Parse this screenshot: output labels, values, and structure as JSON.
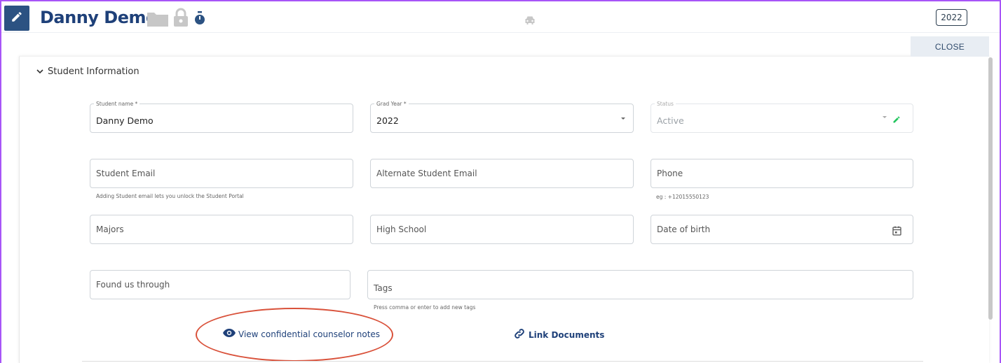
{
  "header": {
    "student_name": "Danny Demo",
    "year_badge": "2022",
    "close_label": "CLOSE"
  },
  "section": {
    "title": "Student Information"
  },
  "fields": {
    "student_name": {
      "label": "Student name *",
      "value": "Danny Demo"
    },
    "grad_year": {
      "label": "Grad Year *",
      "value": "2022"
    },
    "status": {
      "label": "Status",
      "value": "Active"
    },
    "student_email": {
      "placeholder": "Student Email",
      "helper": "Adding Student email lets you unlock the Student Portal"
    },
    "alt_email": {
      "placeholder": "Alternate Student Email"
    },
    "phone": {
      "placeholder": "Phone",
      "helper": "eg : +12015550123"
    },
    "majors": {
      "placeholder": "Majors"
    },
    "high_school": {
      "placeholder": "High School"
    },
    "dob": {
      "placeholder": "Date of birth"
    },
    "found_us": {
      "placeholder": "Found us through"
    },
    "tags": {
      "placeholder": "Tags",
      "helper": "Press comma or enter to add new tags"
    }
  },
  "actions": {
    "view_notes": "View confidential counselor notes",
    "link_documents": "Link Documents"
  },
  "colors": {
    "brand": "#1e4079",
    "edit_box": "#2c5282",
    "highlight_ellipse": "#d9513a",
    "status_edit": "#22c55e",
    "frame": "#a855f7"
  }
}
